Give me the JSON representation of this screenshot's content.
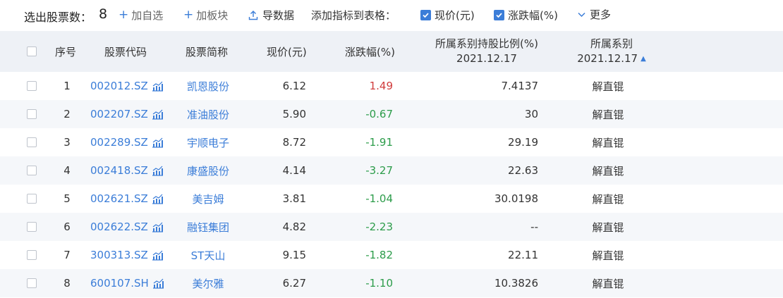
{
  "toolbar": {
    "count_label": "选出股票数：",
    "count": "8",
    "add_watch": "加自选",
    "add_sector": "加板块",
    "export": "导数据",
    "add_indicator_label": "添加指标到表格：",
    "check_price": "现价(元)",
    "check_change": "涨跌幅(%)",
    "more": "更多"
  },
  "columns": {
    "seq": "序号",
    "code": "股票代码",
    "name": "股票简称",
    "price": "现价(元)",
    "change": "涨跌幅(%)",
    "holding_line1": "所属系别持股比例(%)",
    "holding_line2": "2021.12.17",
    "series_line1": "所属系别",
    "series_line2": "2021.12.17",
    "sort_arrow": "▲"
  },
  "colors": {
    "accent": "#3b7dd8",
    "up": "#d03c3c",
    "down": "#2c9c4a",
    "header_bg": "#eef1f6",
    "alt_row_bg": "#f5f7fa"
  },
  "rows": [
    {
      "seq": "1",
      "code": "002012.SZ",
      "name": "凯恩股份",
      "price": "6.12",
      "change": "1.49",
      "dir": "up",
      "holding": "7.4137",
      "series": "解直锟"
    },
    {
      "seq": "2",
      "code": "002207.SZ",
      "name": "准油股份",
      "price": "5.90",
      "change": "-0.67",
      "dir": "down",
      "holding": "30",
      "series": "解直锟"
    },
    {
      "seq": "3",
      "code": "002289.SZ",
      "name": "宇顺电子",
      "price": "8.72",
      "change": "-1.91",
      "dir": "down",
      "holding": "29.19",
      "series": "解直锟"
    },
    {
      "seq": "4",
      "code": "002418.SZ",
      "name": "康盛股份",
      "price": "4.14",
      "change": "-3.27",
      "dir": "down",
      "holding": "22.63",
      "series": "解直锟"
    },
    {
      "seq": "5",
      "code": "002621.SZ",
      "name": "美吉姆",
      "price": "3.81",
      "change": "-1.04",
      "dir": "down",
      "holding": "30.0198",
      "series": "解直锟"
    },
    {
      "seq": "6",
      "code": "002622.SZ",
      "name": "融钰集团",
      "price": "4.82",
      "change": "-2.23",
      "dir": "down",
      "holding": "--",
      "series": "解直锟"
    },
    {
      "seq": "7",
      "code": "300313.SZ",
      "name": "ST天山",
      "price": "9.15",
      "change": "-1.82",
      "dir": "down",
      "holding": "22.11",
      "series": "解直锟"
    },
    {
      "seq": "8",
      "code": "600107.SH",
      "name": "美尔雅",
      "price": "6.27",
      "change": "-1.10",
      "dir": "down",
      "holding": "10.3826",
      "series": "解直锟"
    }
  ]
}
